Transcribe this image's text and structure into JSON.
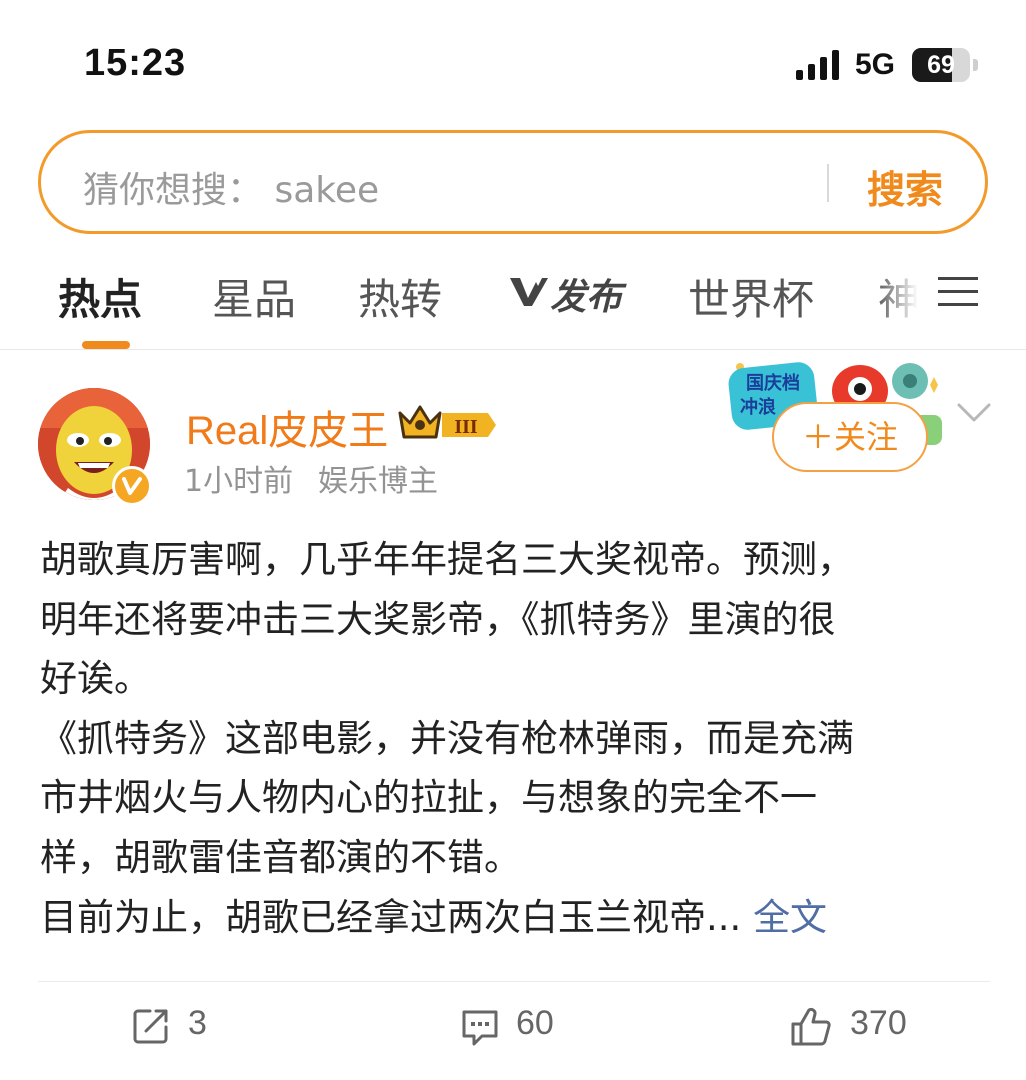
{
  "status_bar": {
    "time": "15:23",
    "network": "5G",
    "battery": "69",
    "battery_level": 0.69
  },
  "search": {
    "placeholder": "猜你想搜：  sakee",
    "button_label": "搜索"
  },
  "tabs": [
    {
      "label": "热点",
      "active": true
    },
    {
      "label": "星品"
    },
    {
      "label": "热转"
    },
    {
      "label": "发布",
      "icon": "v-logo-icon"
    },
    {
      "label": "世界杯"
    },
    {
      "label": "神"
    }
  ],
  "post": {
    "author": "Real皮皮王",
    "level_badge": "III",
    "time": "1小时前",
    "source": "娱乐博主",
    "follow_label": "＋关注",
    "promo_text": [
      "国庆档",
      "冲浪"
    ],
    "body_lines": [
      "胡歌真厉害啊，几乎年年提名三大奖视帝。预测，",
      "明年还将要冲击三大奖影帝，《抓特务》里演的很",
      "好诶。",
      "《抓特务》这部电影，并没有枪林弹雨，而是充满",
      "市井烟火与人物内心的拉扯，与想象的完全不一",
      "样，胡歌雷佳音都演的不错。",
      "目前为止，胡歌已经拿过两次白玉兰视帝..."
    ],
    "read_more": "全文",
    "actions": {
      "repost_count": "3",
      "comment_count": "60",
      "like_count": "370"
    }
  },
  "colors": {
    "accent": "#f08a1c",
    "link": "#506ea5",
    "search_border": "#f39a2b"
  }
}
